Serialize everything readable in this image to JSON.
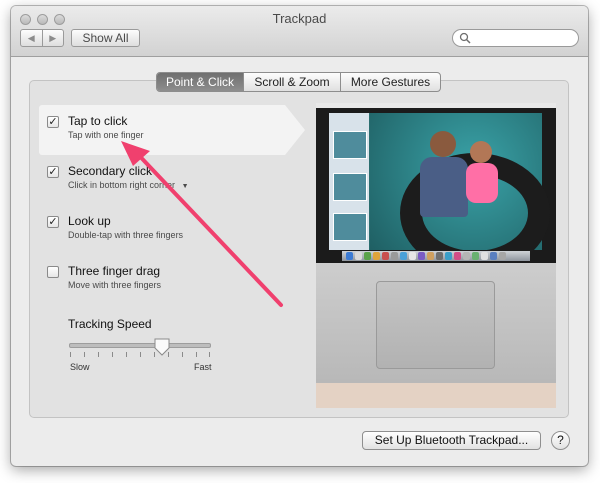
{
  "window": {
    "title": "Trackpad",
    "back_glyph": "◀",
    "forward_glyph": "▶",
    "show_all_label": "Show All",
    "search_placeholder": ""
  },
  "tabs": [
    {
      "label": "Point & Click",
      "active": true
    },
    {
      "label": "Scroll & Zoom",
      "active": false
    },
    {
      "label": "More Gestures",
      "active": false
    }
  ],
  "options": [
    {
      "title": "Tap to click",
      "subtitle": "Tap with one finger",
      "checked": true,
      "check_glyph": "✓"
    },
    {
      "title": "Secondary click",
      "subtitle": "Click in bottom right corner",
      "dropdown_glyph": "▼",
      "checked": true,
      "check_glyph": "✓"
    },
    {
      "title": "Look up",
      "subtitle": "Double-tap with three fingers",
      "checked": true,
      "check_glyph": "✓"
    },
    {
      "title": "Three finger drag",
      "subtitle": "Move with three fingers",
      "checked": false,
      "check_glyph": ""
    }
  ],
  "tracking": {
    "label": "Tracking Speed",
    "slow_label": "Slow",
    "fast_label": "Fast",
    "level": 0.64
  },
  "footer": {
    "bluetooth_button": "Set Up Bluetooth Trackpad...",
    "help_glyph": "?"
  },
  "colors": {
    "annotation_arrow": "#f0406e"
  }
}
